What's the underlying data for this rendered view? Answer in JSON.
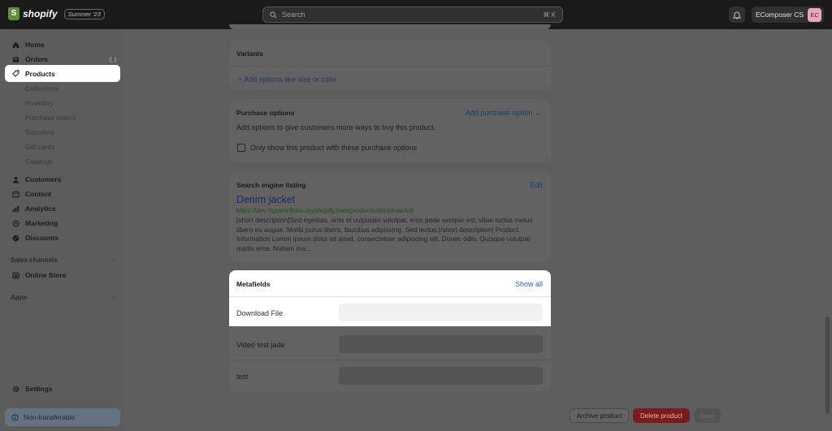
{
  "topbar": {
    "logo_letter": "S",
    "logo_text": "shopify",
    "edition": "Summer '23",
    "search_placeholder": "Search",
    "search_shortcut": "⌘ K",
    "store_name": "EComposer CS",
    "avatar_initials": "EC"
  },
  "sidebar": {
    "home": "Home",
    "orders": "Orders",
    "orders_badge": "1",
    "products": "Products",
    "product_subs": [
      "Collections",
      "Inventory",
      "Purchase orders",
      "Transfers",
      "Gift cards",
      "Catalogs"
    ],
    "customers": "Customers",
    "content": "Content",
    "analytics": "Analytics",
    "marketing": "Marketing",
    "discounts": "Discounts",
    "sales_channels": "Sales channels",
    "online_store": "Online Store",
    "apps": "Apps",
    "settings": "Settings",
    "non_transferable": "Non-transferable"
  },
  "variants": {
    "title": "Variants",
    "add_link": "+ Add options like size or color"
  },
  "purchase_options": {
    "title": "Purchase options",
    "add_link": "Add purchase option",
    "description": "Add options to give customers more ways to buy this product.",
    "checkbox_label": "Only show this product with these purchase options"
  },
  "seo": {
    "title": "Search engine listing",
    "edit": "Edit",
    "page_title": "Denim jacket",
    "url": "https://dev-nguyenthico.myshopify.com/products/denim-jacket",
    "description": "[short description]Sed egestas, ante et vulputate volutpat, eros pede semper est, vitae luctus metus libero eu augue. Morbi purus libero, faucibus adipiscing. Sed lectus.[/short description] Product Information Lorem ipsum dolor sit amet, consectetuer adipiscing elit. Donec odio. Quisque volutpat mattis eros. Nullam ma..."
  },
  "metafields": {
    "title": "Metafields",
    "show_all": "Show all",
    "fields": [
      "Download File",
      "Video test jade",
      "test"
    ]
  },
  "actions": {
    "archive": "Archive product",
    "delete": "Delete product",
    "save": "Save"
  },
  "colors": {
    "delete_button": "#7a1c1c",
    "link": "#1a3c6a",
    "topbar": "#1a1a1a"
  }
}
